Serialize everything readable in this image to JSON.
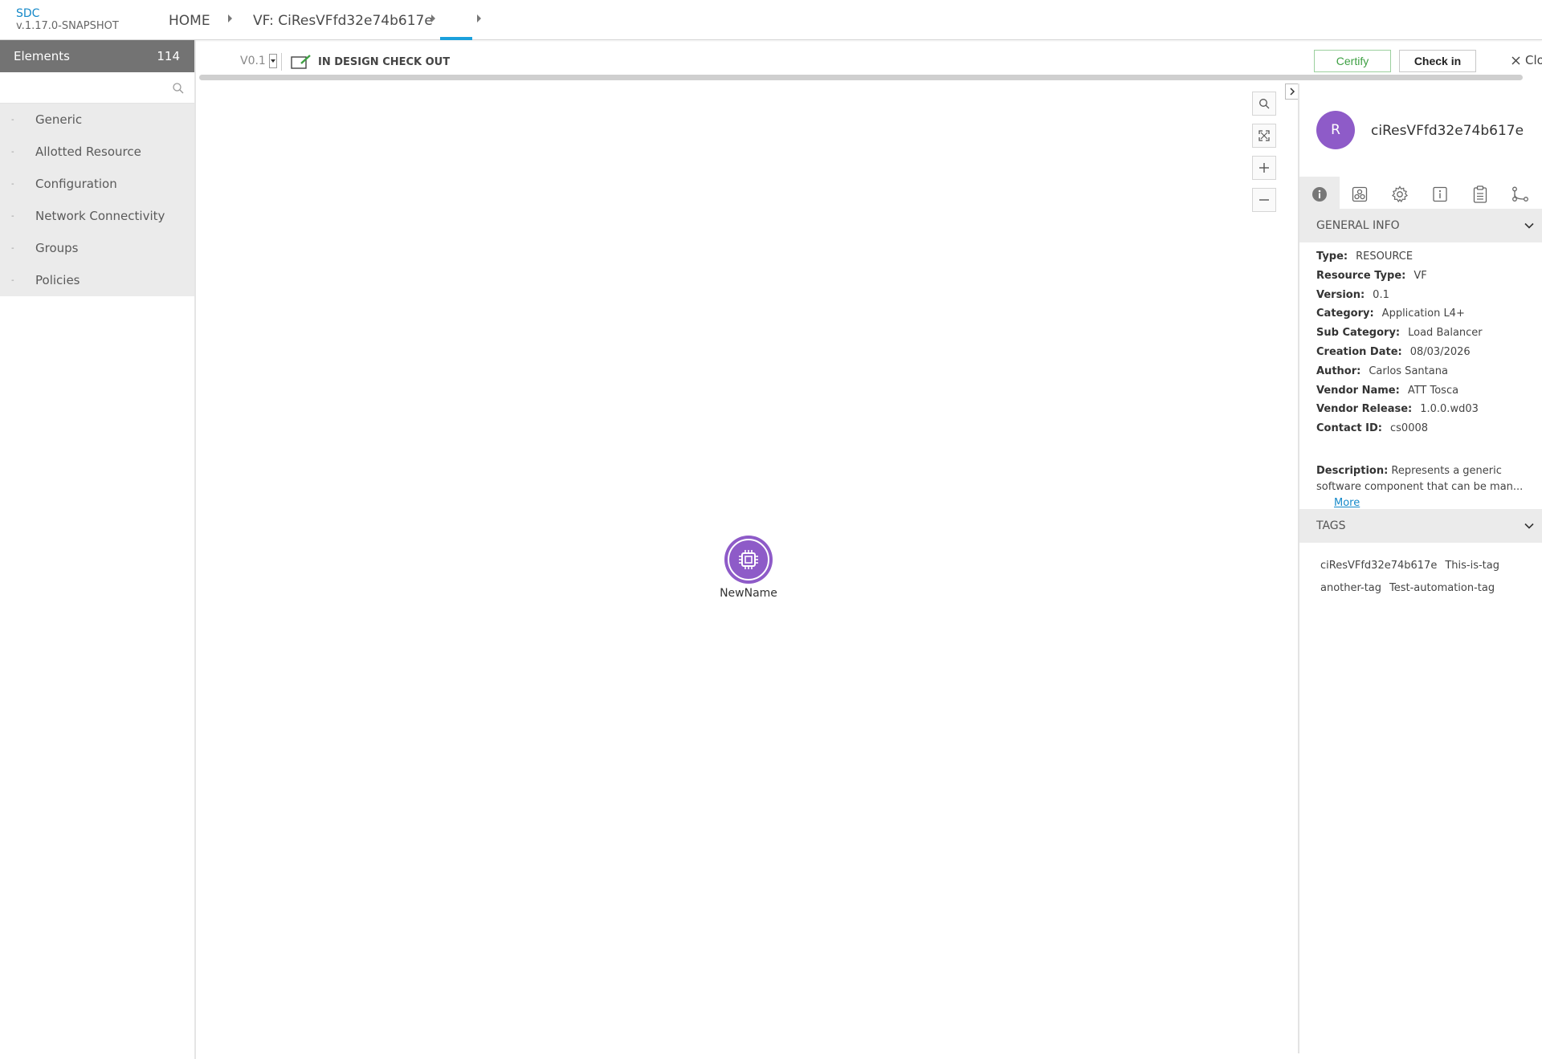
{
  "header": {
    "brand": "SDC",
    "version": "v.1.17.0-SNAPSHOT",
    "breadcrumbs": [
      "HOME",
      "VF: CiResVFfd32e74b617e",
      ""
    ]
  },
  "left_panel": {
    "title": "Elements",
    "count": "114",
    "search_placeholder": "",
    "categories": [
      "Generic",
      "Allotted Resource",
      "Configuration",
      "Network Connectivity",
      "Groups",
      "Policies"
    ]
  },
  "toolbar": {
    "version": "V0.1",
    "status": "IN DESIGN CHECK OUT",
    "certify_label": "Certify",
    "checkin_label": "Check in",
    "close_label": "Clo"
  },
  "canvas": {
    "node_label": "NewName",
    "zoom_icons": [
      "search-icon",
      "fit-screen-icon",
      "zoom-in-icon",
      "zoom-out-icon"
    ]
  },
  "right_panel": {
    "avatar_letter": "R",
    "title": "ciResVFfd32e74b617e",
    "tab_icons": [
      "info-icon",
      "deployment-icon",
      "gear-icon",
      "properties-icon",
      "clipboard-icon",
      "composition-icon"
    ],
    "general_info_title": "GENERAL INFO",
    "info": [
      {
        "label": "Type:",
        "value": "RESOURCE"
      },
      {
        "label": "Resource Type:",
        "value": "VF"
      },
      {
        "label": "Version:",
        "value": "0.1"
      },
      {
        "label": "Category:",
        "value": "Application L4+"
      },
      {
        "label": "Sub Category:",
        "value": "Load Balancer"
      },
      {
        "label": "Creation Date:",
        "value": "08/03/2026"
      },
      {
        "label": "Author:",
        "value": "Carlos Santana"
      },
      {
        "label": "Vendor Name:",
        "value": "ATT Tosca"
      },
      {
        "label": "Vendor Release:",
        "value": "1.0.0.wd03"
      },
      {
        "label": "Contact ID:",
        "value": "cs0008"
      }
    ],
    "description_label": "Description:",
    "description": "Represents a generic software component that can be man...",
    "more_label": "More",
    "tags_title": "TAGS",
    "tags": [
      "ciResVFfd32e74b617e",
      "This-is-tag",
      "another-tag",
      "Test-automation-tag"
    ]
  },
  "colors": {
    "accent": "#1ba0dc",
    "node": "#8e5bc8",
    "certify": "#3ea043",
    "panel_header": "#737373"
  }
}
